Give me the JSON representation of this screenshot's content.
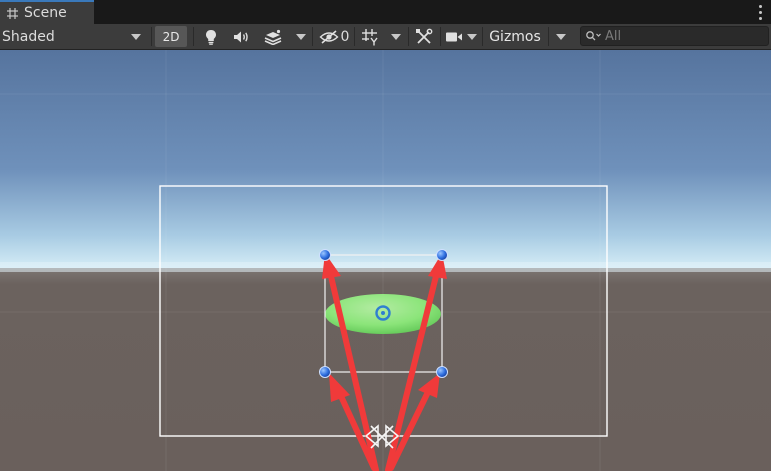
{
  "tab": {
    "title": "Scene",
    "icon": "grid-hash-icon"
  },
  "toolbar": {
    "shading_mode": "Shaded",
    "mode_2d_label": "2D",
    "lighting_icon": "lightbulb-icon",
    "audio_icon": "speaker-icon",
    "effects_icon": "effects-layers-icon",
    "visibility_icon": "eye-slash-icon",
    "hidden_count": "0",
    "grid_icon": "grid-snap-icon",
    "tools_icon": "tools-crossed-icon",
    "camera_icon": "camera-icon",
    "gizmos_label": "Gizmos",
    "search_placeholder": "All",
    "search_value": ""
  },
  "colors": {
    "sky_top": "#56749e",
    "horizon": "#cde7f3",
    "ground": "#6d625e",
    "selection_frame": "#ffffff",
    "handle": "#2f6fe0",
    "arrow": "#f03a3a",
    "ellipse": "#8ef07c"
  }
}
